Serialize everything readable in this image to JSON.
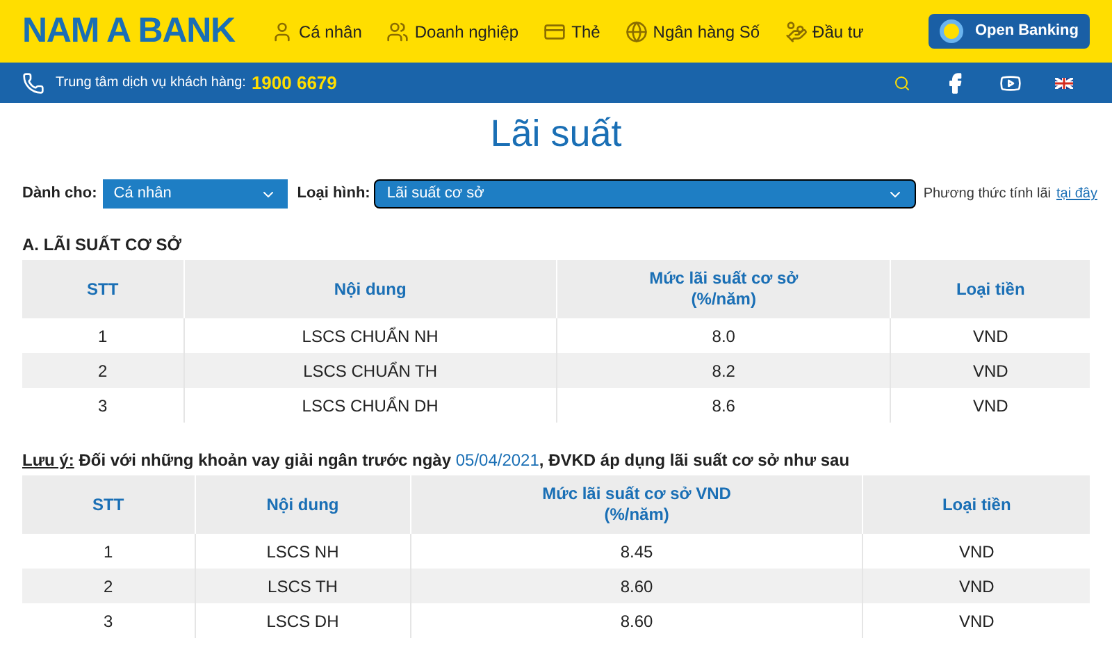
{
  "header": {
    "logo": "NAM A BANK",
    "nav": [
      {
        "label": "Cá nhân",
        "kind": "person"
      },
      {
        "label": "Doanh nghiệp",
        "kind": "group"
      },
      {
        "label": "Thẻ",
        "kind": "card"
      },
      {
        "label": "Ngân hàng Số",
        "kind": "globe"
      },
      {
        "label": "Đầu tư",
        "kind": "money"
      }
    ],
    "open_banking": "Open Banking"
  },
  "info_bar": {
    "label": "Trung tâm dịch vụ khách hàng:",
    "phone": "1900 6679"
  },
  "title": "Lãi suất",
  "filters": {
    "for_label": "Dành cho:",
    "for_value": "Cá nhân",
    "type_label": "Loại hình:",
    "type_value": "Lãi suất cơ sở",
    "method_text": "Phương thức tính lãi",
    "method_link": "tại đây"
  },
  "section_a": {
    "heading": "A. LÃI SUẤT CƠ SỞ",
    "columns": [
      "STT",
      "Nội dung",
      "Mức lãi suất cơ sở\n(%/năm)",
      "Loại tiền"
    ],
    "rows": [
      [
        "1",
        "LSCS CHUẨN NH",
        "8.0",
        "VND"
      ],
      [
        "2",
        "LSCS CHUẨN TH",
        "8.2",
        "VND"
      ],
      [
        "3",
        "LSCS CHUẨN DH",
        "8.6",
        "VND"
      ]
    ]
  },
  "note": {
    "label": "Lưu ý:",
    "before": " Đối với những khoản vay giải ngân trước ngày ",
    "date": "05/04/2021",
    "after": ", ĐVKD áp dụng lãi suất cơ sở như sau"
  },
  "section_b": {
    "columns": [
      "STT",
      "Nội dung",
      "Mức lãi suất cơ sở VND\n(%/năm)",
      "Loại tiền"
    ],
    "rows": [
      [
        "1",
        "LSCS NH",
        "8.45",
        "VND"
      ],
      [
        "2",
        "LSCS TH",
        "8.60",
        "VND"
      ],
      [
        "3",
        "LSCS DH",
        "8.60",
        "VND"
      ]
    ]
  }
}
